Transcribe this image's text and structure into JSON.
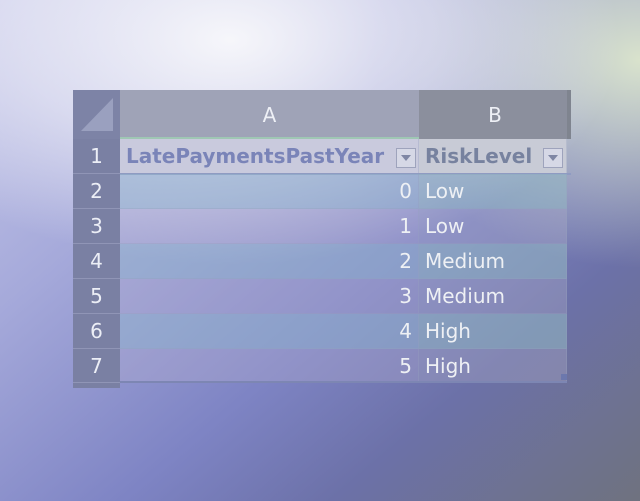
{
  "columns": [
    "A",
    "B"
  ],
  "rows": [
    "1",
    "2",
    "3",
    "4",
    "5",
    "6",
    "7"
  ],
  "table": {
    "headers": [
      "LatePaymentsPastYear",
      "RiskLevel"
    ],
    "data": [
      [
        "0",
        "Low"
      ],
      [
        "1",
        "Low"
      ],
      [
        "2",
        "Medium"
      ],
      [
        "3",
        "Medium"
      ],
      [
        "4",
        "High"
      ],
      [
        "5",
        "High"
      ]
    ]
  },
  "icons": {
    "filter": "chevron-down-icon",
    "corner": "select-all-icon",
    "resize": "table-resize-handle-icon"
  }
}
